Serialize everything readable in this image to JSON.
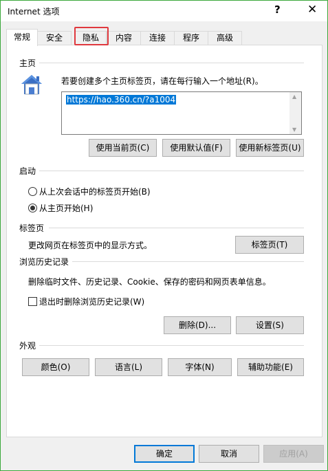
{
  "window": {
    "title": "Internet 选项",
    "help": "?",
    "close": "✕"
  },
  "tabs": [
    {
      "label": "常规",
      "active": true
    },
    {
      "label": "安全",
      "active": false
    },
    {
      "label": "隐私",
      "active": false
    },
    {
      "label": "内容",
      "active": false
    },
    {
      "label": "连接",
      "active": false
    },
    {
      "label": "程序",
      "active": false
    },
    {
      "label": "高级",
      "active": false
    }
  ],
  "homepage": {
    "title": "主页",
    "description": "若要创建多个主页标签页，请在每行输入一个地址(R)。",
    "url": "https://hao.360.cn/?a1004",
    "use_current": "使用当前页(C)",
    "use_default": "使用默认值(F)",
    "use_new_tab": "使用新标签页(U)"
  },
  "startup": {
    "title": "启动",
    "option1": "从上次会话中的标签页开始(B)",
    "option2": "从主页开始(H)",
    "selected": "option2"
  },
  "tabs_section": {
    "title": "标签页",
    "description": "更改网页在标签页中的显示方式。",
    "button": "标签页(T)"
  },
  "history": {
    "title": "浏览历史记录",
    "description": "删除临时文件、历史记录、Cookie、保存的密码和网页表单信息。",
    "checkbox_label": "退出时删除浏览历史记录(W)",
    "checkbox_checked": false,
    "delete": "删除(D)...",
    "settings": "设置(S)"
  },
  "appearance": {
    "title": "外观",
    "colors": "颜色(O)",
    "languages": "语言(L)",
    "fonts": "字体(N)",
    "accessibility": "辅助功能(E)"
  },
  "footer": {
    "ok": "确定",
    "cancel": "取消",
    "apply": "应用(A)"
  },
  "colors": {
    "accent": "#0078d7",
    "highlight_box": "#e0383e",
    "window_border": "#3ba83b"
  }
}
